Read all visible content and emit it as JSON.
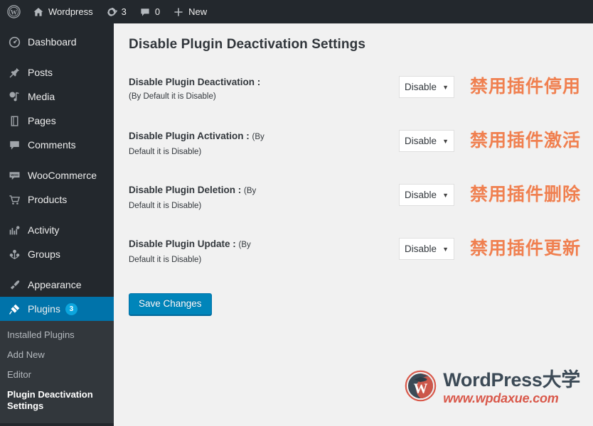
{
  "adminbar": {
    "logo_icon": "wordpress-logo-icon",
    "site": {
      "icon": "home-icon",
      "label": "Wordpress"
    },
    "updates": {
      "icon": "updates-icon",
      "count": "3"
    },
    "comments": {
      "icon": "comment-bubble-icon",
      "count": "0"
    },
    "new": {
      "icon": "plus-icon",
      "label": "New"
    }
  },
  "sidebar": {
    "items": [
      {
        "label": "Dashboard",
        "icon": "dashboard-icon",
        "sep_before": true
      },
      {
        "label": "Posts",
        "icon": "pin-icon",
        "sep_before": true
      },
      {
        "label": "Media",
        "icon": "media-icon",
        "sep_before": false
      },
      {
        "label": "Pages",
        "icon": "pages-icon",
        "sep_before": false
      },
      {
        "label": "Comments",
        "icon": "comment-bubble-icon",
        "sep_before": false
      },
      {
        "label": "WooCommerce",
        "icon": "woocommerce-icon",
        "sep_before": true
      },
      {
        "label": "Products",
        "icon": "cart-icon",
        "sep_before": false
      },
      {
        "label": "Activity",
        "icon": "activity-icon",
        "sep_before": true
      },
      {
        "label": "Groups",
        "icon": "groups-icon",
        "sep_before": false
      },
      {
        "label": "Appearance",
        "icon": "brush-icon",
        "sep_before": true
      },
      {
        "label": "Plugins",
        "icon": "plug-icon",
        "badge": "3",
        "current": true,
        "sep_before": false
      }
    ],
    "submenu": [
      {
        "label": "Installed Plugins",
        "current": false
      },
      {
        "label": "Add New",
        "current": false
      },
      {
        "label": "Editor",
        "current": false
      },
      {
        "label": "Plugin Deactivation Settings",
        "current": true
      }
    ]
  },
  "main": {
    "title": "Disable Plugin Deactivation Settings",
    "rows": [
      {
        "label": "Disable Plugin Deactivation :",
        "sublabel": "(By Default it is Disable)",
        "inline": false,
        "select_value": "Disable",
        "annotation": "禁用插件停用"
      },
      {
        "label": "Disable Plugin Activation :",
        "sublabel": "(By Default it is Disable)",
        "inline": true,
        "select_value": "Disable",
        "annotation": "禁用插件激活"
      },
      {
        "label": "Disable Plugin Deletion :",
        "sublabel": "(By Default it is Disable)",
        "inline": true,
        "select_value": "Disable",
        "annotation": "禁用插件删除"
      },
      {
        "label": "Disable Plugin Update :",
        "sublabel": "(By Default it is Disable)",
        "inline": true,
        "select_value": "Disable",
        "annotation": "禁用插件更新"
      }
    ],
    "save_label": "Save Changes",
    "select_caret": "▼"
  },
  "watermark": {
    "logo_icon": "wordpress-daxue-logo-icon",
    "title": "WordPress大学",
    "url": "www.wpdaxue.com"
  },
  "colors": {
    "admin_bar": "#23282d",
    "sidebar": "#23282d",
    "submenu": "#32373c",
    "accent_blue": "#0073aa",
    "button_blue": "#0085ba",
    "badge_blue": "#0ca5dd",
    "content_bg": "#f1f1f1",
    "annotation_orange": "#f08050",
    "watermark_red": "#d9584a"
  }
}
